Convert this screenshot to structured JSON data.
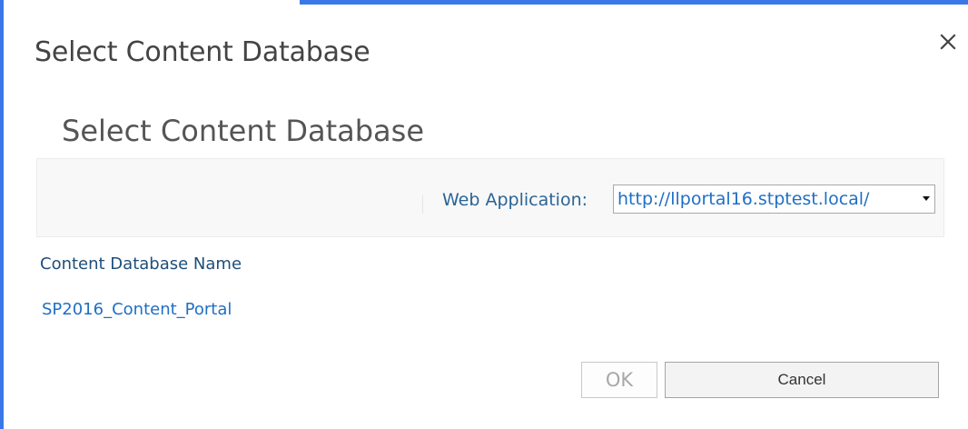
{
  "dialog": {
    "title": "Select Content Database",
    "close_icon": "close-icon"
  },
  "page": {
    "heading": "Select Content Database"
  },
  "toolbar": {
    "web_application_label": "Web Application:",
    "web_application_value": "http://llportal16.stptest.local/",
    "dropdown_icon": "caret-down-icon"
  },
  "table": {
    "column_header": "Content Database Name",
    "rows": [
      {
        "name": "SP2016_Content_Portal"
      }
    ]
  },
  "buttons": {
    "ok_label": "OK",
    "cancel_label": "Cancel"
  },
  "colors": {
    "frame_border": "#3b78e7",
    "link": "#1f6fc5",
    "label": "#2a6496"
  }
}
